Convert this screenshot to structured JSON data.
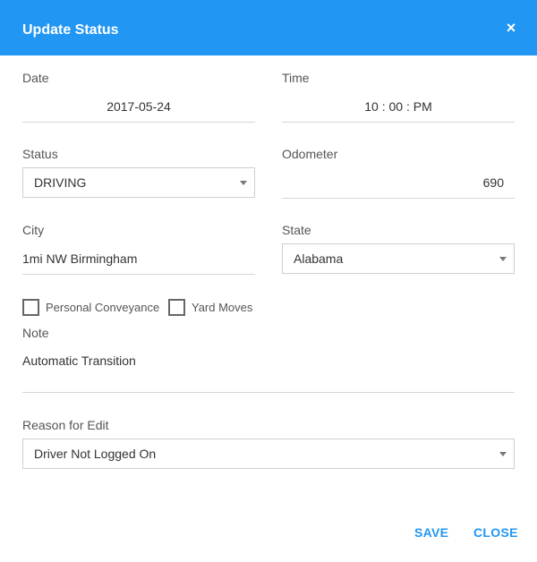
{
  "dialog": {
    "title": "Update Status",
    "close_glyph": "×"
  },
  "fields": {
    "date": {
      "label": "Date",
      "value": "2017-05-24"
    },
    "time": {
      "label": "Time",
      "value": "10 : 00 : PM"
    },
    "status": {
      "label": "Status",
      "value": "DRIVING"
    },
    "odometer": {
      "label": "Odometer",
      "value": "690"
    },
    "city": {
      "label": "City",
      "value": "1mi NW Birmingham"
    },
    "state": {
      "label": "State",
      "value": "Alabama"
    },
    "note": {
      "label": "Note",
      "value": "Automatic Transition"
    },
    "reason": {
      "label": "Reason for Edit",
      "value": "Driver Not Logged On"
    }
  },
  "checkboxes": {
    "personal_conveyance": {
      "label": "Personal Conveyance",
      "checked": false
    },
    "yard_moves": {
      "label": "Yard Moves",
      "checked": false
    }
  },
  "footer": {
    "save_label": "SAVE",
    "close_label": "CLOSE"
  },
  "colors": {
    "accent": "#2196f3",
    "header_text": "#ffffff"
  }
}
